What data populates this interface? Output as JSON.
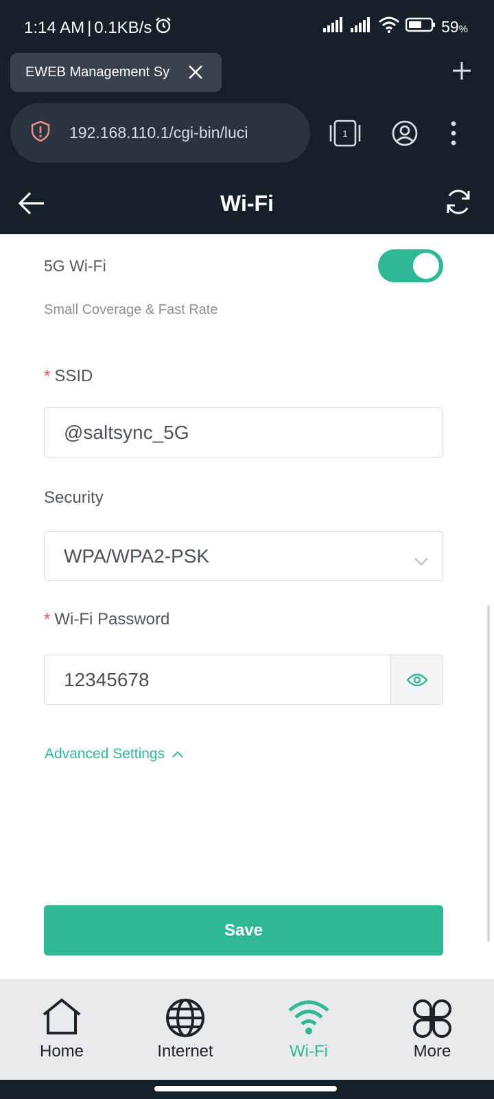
{
  "status_bar": {
    "time": "1:14 AM",
    "net_speed": "0.1KB/s",
    "battery_percent": "59",
    "battery_unit": "%"
  },
  "browser": {
    "tab_title": "EWEB Management Sy",
    "url": "192.168.110.1/cgi-bin/luci",
    "open_tabs": "1"
  },
  "header": {
    "title": "Wi-Fi"
  },
  "form": {
    "five_g_label": "5G Wi-Fi",
    "five_g_enabled": true,
    "five_g_hint": "Small Coverage & Fast Rate",
    "ssid_label": "SSID",
    "ssid_value": "@saltsync_5G",
    "security_label": "Security",
    "security_value": "WPA/WPA2-PSK",
    "password_label": "Wi-Fi Password",
    "password_value": "12345678",
    "advanced_label": "Advanced Settings",
    "required_mark": "*",
    "save_label": "Save"
  },
  "bottom_nav": {
    "items": [
      {
        "label": "Home",
        "icon": "home-icon"
      },
      {
        "label": "Internet",
        "icon": "globe-icon"
      },
      {
        "label": "Wi-Fi",
        "icon": "wifi-icon",
        "active": true
      },
      {
        "label": "More",
        "icon": "more-icon"
      }
    ]
  },
  "colors": {
    "accent": "#2fb893",
    "dark_bg": "#16202a",
    "required": "#d9544f"
  }
}
